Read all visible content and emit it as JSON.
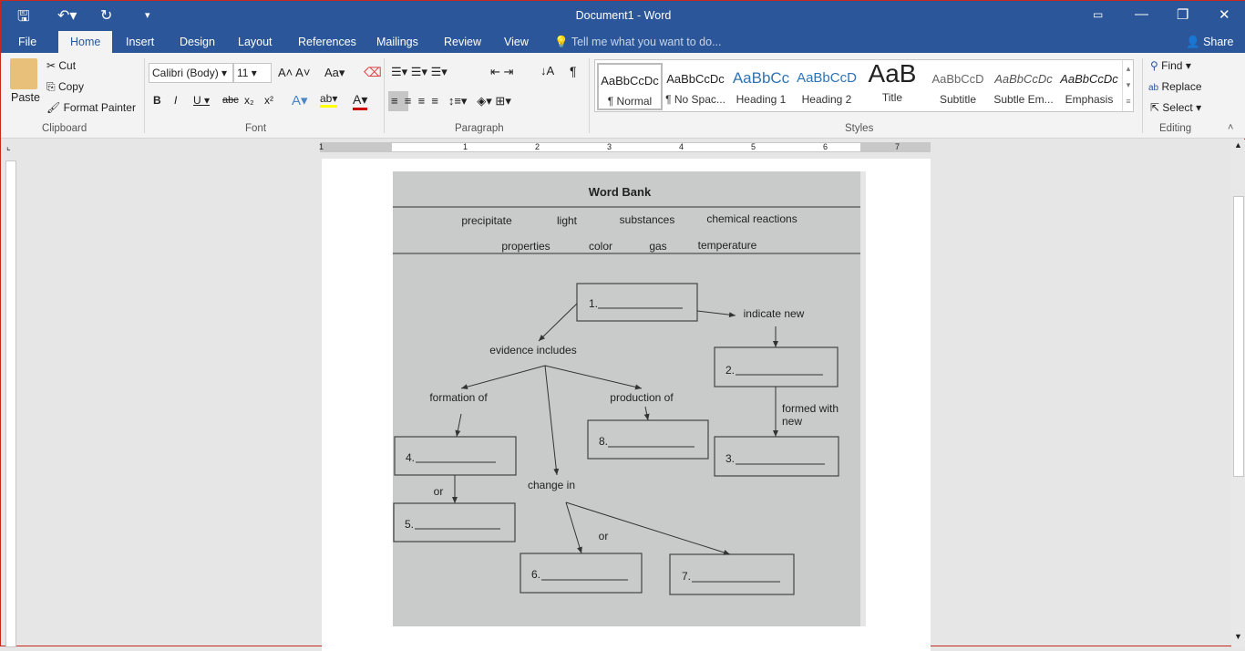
{
  "title": "Document1 - Word",
  "tabs": [
    "File",
    "Home",
    "Insert",
    "Design",
    "Layout",
    "References",
    "Mailings",
    "Review",
    "View"
  ],
  "tell_me": "Tell me what you want to do...",
  "share": "Share",
  "clipboard": {
    "paste": "Paste",
    "cut": "Cut",
    "copy": "Copy",
    "format_painter": "Format Painter",
    "label": "Clipboard"
  },
  "font": {
    "name": "Calibri (Body)",
    "size": "11",
    "label": "Font",
    "case": "Aa"
  },
  "paragraph": {
    "label": "Paragraph"
  },
  "styles": {
    "label": "Styles",
    "items": [
      {
        "preview": "AaBbCcDc",
        "name": "¶ Normal"
      },
      {
        "preview": "AaBbCcDc",
        "name": "¶ No Spac..."
      },
      {
        "preview": "AaBbCc",
        "name": "Heading 1"
      },
      {
        "preview": "AaBbCcD",
        "name": "Heading 2"
      },
      {
        "preview": "AaB",
        "name": "Title"
      },
      {
        "preview": "AaBbCcD",
        "name": "Subtitle"
      },
      {
        "preview": "AaBbCcDc",
        "name": "Subtle Em..."
      },
      {
        "preview": "AaBbCcDc",
        "name": "Emphasis"
      }
    ]
  },
  "editing": {
    "find": "Find",
    "replace": "Replace",
    "select": "Select",
    "label": "Editing"
  },
  "ruler": [
    "1",
    "1",
    "2",
    "3",
    "4",
    "5",
    "6",
    "7"
  ],
  "worksheet": {
    "word_bank_title": "Word Bank",
    "row1": [
      "precipitate",
      "light",
      "substances",
      "chemical reactions"
    ],
    "row2": [
      "properties",
      "color",
      "gas",
      "temperature"
    ],
    "boxes": [
      "1.",
      "2.",
      "3.",
      "4.",
      "5.",
      "6.",
      "7.",
      "8."
    ],
    "labels": {
      "indicate_new": "indicate new",
      "evidence": "evidence includes",
      "formation": "formation of",
      "production": "production of",
      "formed_with": "formed with",
      "new": "new",
      "or1": "or",
      "change_in": "change in",
      "or2": "or"
    }
  },
  "colors": {
    "accent": "#2b579a"
  }
}
